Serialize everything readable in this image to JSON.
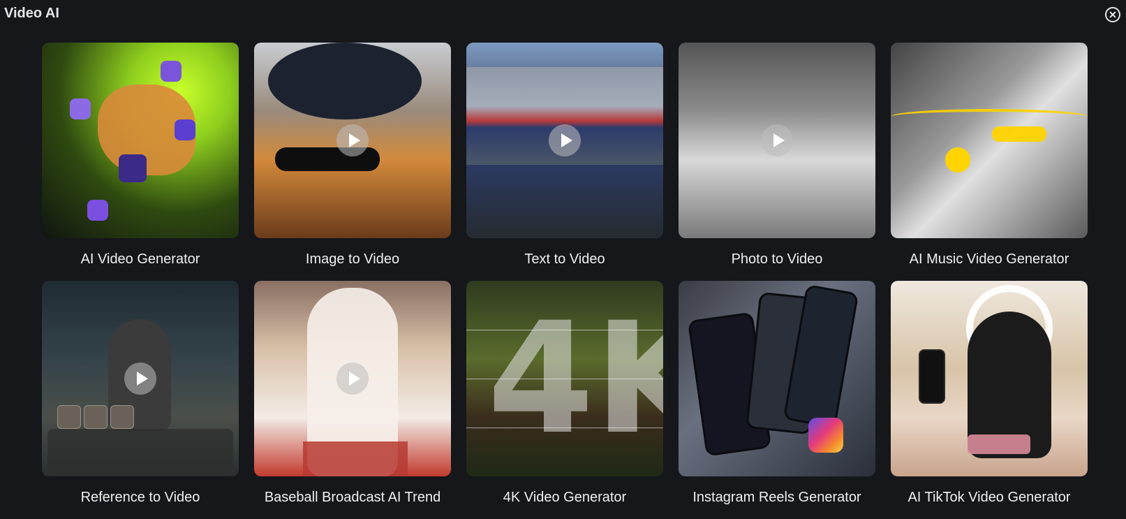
{
  "header": {
    "title": "Video AI",
    "close_icon": "close-icon"
  },
  "cards": [
    {
      "label": "AI Video Generator",
      "has_play": false
    },
    {
      "label": "Image to Video",
      "has_play": true
    },
    {
      "label": "Text to Video",
      "has_play": true
    },
    {
      "label": "Photo to Video",
      "has_play": true
    },
    {
      "label": "AI Music Video Generator",
      "has_play": false
    },
    {
      "label": "Reference to Video",
      "has_play": true
    },
    {
      "label": "Baseball Broadcast AI Trend",
      "has_play": true
    },
    {
      "label": "4K Video Generator",
      "has_play": false
    },
    {
      "label": "Instagram Reels Generator",
      "has_play": false
    },
    {
      "label": "AI TikTok Video Generator",
      "has_play": false
    }
  ],
  "thumb_text": {
    "fourk": "4K"
  }
}
